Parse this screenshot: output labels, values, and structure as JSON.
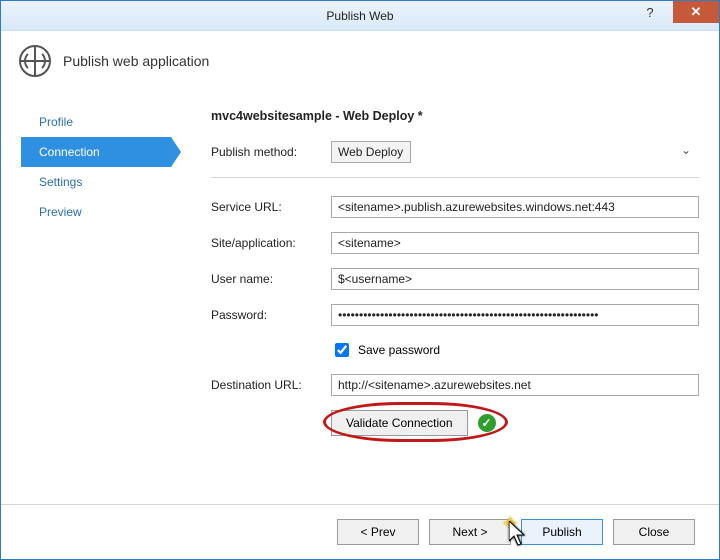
{
  "window": {
    "title": "Publish Web"
  },
  "header": {
    "subtitle": "Publish web application"
  },
  "nav": {
    "profile": "Profile",
    "connection": "Connection",
    "settings": "Settings",
    "preview": "Preview"
  },
  "main": {
    "heading": "mvc4websitesample - Web Deploy *",
    "publish_method_label": "Publish method:",
    "publish_method_value": "Web Deploy",
    "service_url_label": "Service URL:",
    "service_url_value": "<sitename>.publish.azurewebsites.windows.net:443",
    "site_app_label": "Site/application:",
    "site_app_value": "<sitename>",
    "username_label": "User name:",
    "username_value": "$<username>",
    "password_label": "Password:",
    "password_value": "••••••••••••••••••••••••••••••••••••••••••••••••••••••••••••••",
    "save_password_label": "Save password",
    "destination_label": "Destination URL:",
    "destination_value": "http://<sitename>.azurewebsites.net",
    "validate_label": "Validate Connection"
  },
  "footer": {
    "prev": "< Prev",
    "next": "Next >",
    "publish": "Publish",
    "close": "Close"
  }
}
